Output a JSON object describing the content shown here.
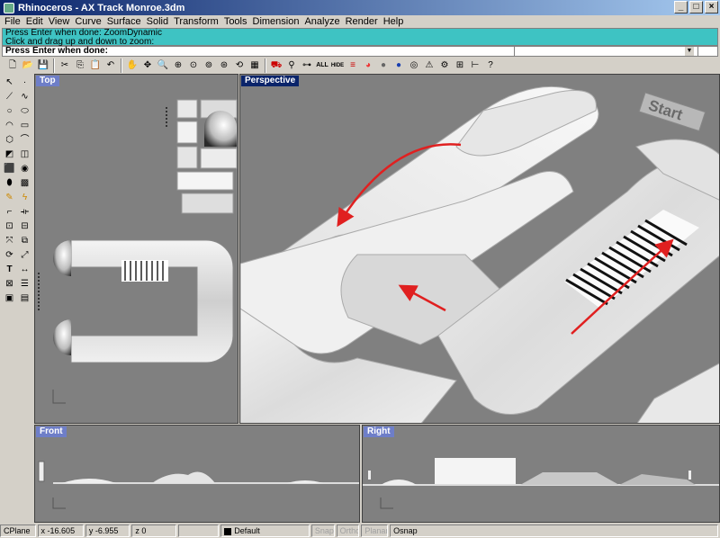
{
  "window": {
    "title": "Rhinoceros - AX Track Monroe.3dm"
  },
  "menu": [
    "File",
    "Edit",
    "View",
    "Curve",
    "Surface",
    "Solid",
    "Transform",
    "Tools",
    "Dimension",
    "Analyze",
    "Render",
    "Help"
  ],
  "command": {
    "history": [
      "Press Enter when done: ZoomDynamic",
      "Click and drag up and down to zoom:"
    ],
    "prompt": "Press Enter when done:"
  },
  "viewports": {
    "top": "Top",
    "perspective": "Perspective",
    "front": "Front",
    "right": "Right"
  },
  "perspective_text": "Start",
  "toolbar": {
    "all_label": "ALL",
    "hide_label": "HIDE"
  },
  "status": {
    "cplane": "CPlane",
    "x": "x -16.605",
    "y": "y -6.955",
    "z": "z 0",
    "layer": "Default",
    "snap": "Snap",
    "ortho": "Ortho",
    "planar": "Planar",
    "osnap": "Osnap"
  },
  "colors": {
    "arrow": "#e02020",
    "command_bg": "#3ec3c3",
    "viewport_bg": "#808080",
    "viewport_label": "#6e7ec8"
  }
}
